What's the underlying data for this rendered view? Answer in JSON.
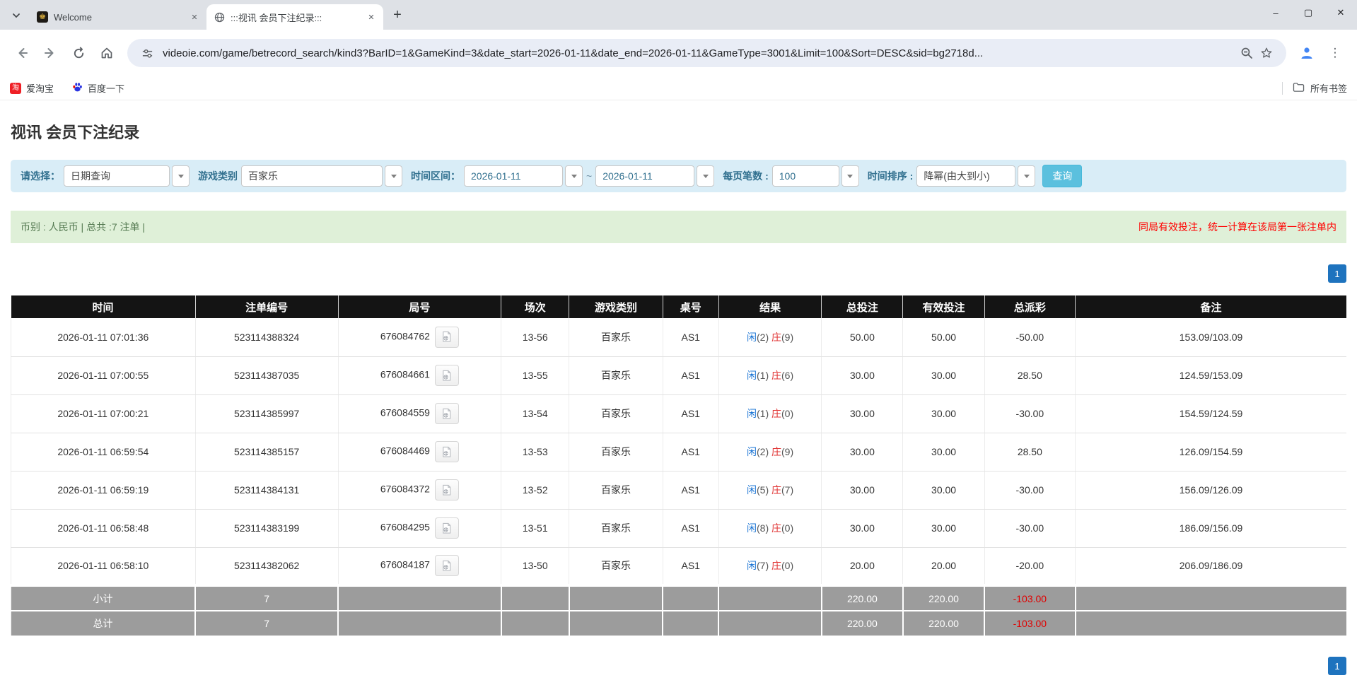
{
  "browser": {
    "tabs": [
      {
        "title": "Welcome"
      },
      {
        "title": ":::视讯 会员下注纪录:::"
      }
    ],
    "url": "videoie.com/game/betrecord_search/kind3?BarID=1&GameKind=3&date_start=2026-01-11&date_end=2026-01-11&GameType=3001&Limit=100&Sort=DESC&sid=bg2718d...",
    "bookmarks": [
      {
        "label": "爱淘宝"
      },
      {
        "label": "百度一下"
      }
    ],
    "all_bookmarks_label": "所有书签",
    "icons": {
      "minimize": "–",
      "maximize": "▢",
      "close": "✕",
      "tab_close": "✕",
      "new_tab": "+",
      "kebab": "⋮",
      "welcome_favicon_glyph": "♚",
      "taobao_glyph": "淘"
    }
  },
  "page": {
    "title": "视讯 会员下注纪录",
    "filters": {
      "select_label": "请选择：",
      "select_value": "日期查询",
      "game_kind_label": "游戏类别",
      "game_kind_value": "百家乐",
      "date_range_label": "时间区间：",
      "date_start": "2026-01-11",
      "date_tilde": "~",
      "date_end": "2026-01-11",
      "per_page_label": "每页笔数 :",
      "per_page_value": "100",
      "sort_label": "时间排序 :",
      "sort_value": "降幂(由大到小)",
      "search_button": "查询"
    },
    "summary": {
      "left": "币别 : 人民币 | 总共 :7 注单 |",
      "right": "同局有效投注，统一计算在该局第一张注单内"
    },
    "pagination": {
      "page": "1"
    },
    "table": {
      "headers": [
        "时间",
        "注单编号",
        "局号",
        "场次",
        "游戏类别",
        "桌号",
        "结果",
        "总投注",
        "有效投注",
        "总派彩",
        "备注"
      ],
      "rows": [
        {
          "time": "2026-01-11 07:01:36",
          "bet_id": "523114388324",
          "round": "676084762",
          "session": "13-56",
          "game": "百家乐",
          "table": "AS1",
          "player": "闲",
          "player_score": "(2)",
          "banker": "庄",
          "banker_score": "(9)",
          "total_bet": "50.00",
          "valid_bet": "50.00",
          "payout": "-50.00",
          "note": "153.09/103.09"
        },
        {
          "time": "2026-01-11 07:00:55",
          "bet_id": "523114387035",
          "round": "676084661",
          "session": "13-55",
          "game": "百家乐",
          "table": "AS1",
          "player": "闲",
          "player_score": "(1)",
          "banker": "庄",
          "banker_score": "(6)",
          "total_bet": "30.00",
          "valid_bet": "30.00",
          "payout": "28.50",
          "note": "124.59/153.09"
        },
        {
          "time": "2026-01-11 07:00:21",
          "bet_id": "523114385997",
          "round": "676084559",
          "session": "13-54",
          "game": "百家乐",
          "table": "AS1",
          "player": "闲",
          "player_score": "(1)",
          "banker": "庄",
          "banker_score": "(0)",
          "total_bet": "30.00",
          "valid_bet": "30.00",
          "payout": "-30.00",
          "note": "154.59/124.59"
        },
        {
          "time": "2026-01-11 06:59:54",
          "bet_id": "523114385157",
          "round": "676084469",
          "session": "13-53",
          "game": "百家乐",
          "table": "AS1",
          "player": "闲",
          "player_score": "(2)",
          "banker": "庄",
          "banker_score": "(9)",
          "total_bet": "30.00",
          "valid_bet": "30.00",
          "payout": "28.50",
          "note": "126.09/154.59"
        },
        {
          "time": "2026-01-11 06:59:19",
          "bet_id": "523114384131",
          "round": "676084372",
          "session": "13-52",
          "game": "百家乐",
          "table": "AS1",
          "player": "闲",
          "player_score": "(5)",
          "banker": "庄",
          "banker_score": "(7)",
          "total_bet": "30.00",
          "valid_bet": "30.00",
          "payout": "-30.00",
          "note": "156.09/126.09"
        },
        {
          "time": "2026-01-11 06:58:48",
          "bet_id": "523114383199",
          "round": "676084295",
          "session": "13-51",
          "game": "百家乐",
          "table": "AS1",
          "player": "闲",
          "player_score": "(8)",
          "banker": "庄",
          "banker_score": "(0)",
          "total_bet": "30.00",
          "valid_bet": "30.00",
          "payout": "-30.00",
          "note": "186.09/156.09"
        },
        {
          "time": "2026-01-11 06:58:10",
          "bet_id": "523114382062",
          "round": "676084187",
          "session": "13-50",
          "game": "百家乐",
          "table": "AS1",
          "player": "闲",
          "player_score": "(7)",
          "banker": "庄",
          "banker_score": "(0)",
          "total_bet": "20.00",
          "valid_bet": "20.00",
          "payout": "-20.00",
          "note": "206.09/186.09"
        }
      ],
      "subtotal": {
        "label": "小计",
        "count": "7",
        "total_bet": "220.00",
        "valid_bet": "220.00",
        "payout": "-103.00"
      },
      "total": {
        "label": "总计",
        "count": "7",
        "total_bet": "220.00",
        "valid_bet": "220.00",
        "payout": "-103.00"
      }
    }
  },
  "colors": {
    "accent_blue": "#1a74d4",
    "banker_red": "#e03333",
    "negative_red": "#ef0000",
    "filter_bg": "#d9edf7",
    "filter_label": "#31708f",
    "summary_bg": "#dff0d8",
    "header_bg": "#141414",
    "footer_bg": "#9c9c9c",
    "search_button_bg": "#5bc0de",
    "pager_bg": "#1e73be"
  }
}
